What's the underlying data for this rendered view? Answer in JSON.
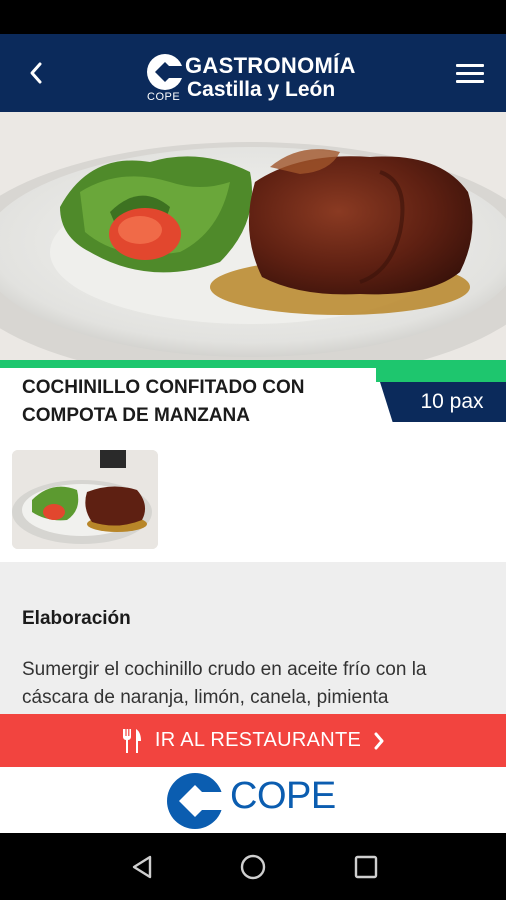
{
  "app": {
    "brand_line1": "GASTRONOMÍA",
    "brand_line2": "Castilla y León",
    "brand_small": "COPE"
  },
  "colors": {
    "appbar": "#0b2a5b",
    "accent_green": "#1ec66e",
    "cta_red": "#f2443f",
    "cope_blue": "#0b5db0"
  },
  "icons": {
    "back": "chevron-left-icon",
    "menu": "hamburger-menu-icon",
    "cta": "fork-knife-icon",
    "cta_arrow": "chevron-right-icon"
  },
  "recipe": {
    "title": "COCHINILLO CONFITADO CON COMPOTA DE MANZANA",
    "servings": "10 pax"
  },
  "section": {
    "title": "Elaboración",
    "body": "Sumergir el cochinillo crudo en aceite frío con la cáscara de naranja, limón, canela, pimienta"
  },
  "cta": {
    "label": "IR AL RESTAURANTE"
  },
  "footer": {
    "logo_text": "COPE"
  }
}
